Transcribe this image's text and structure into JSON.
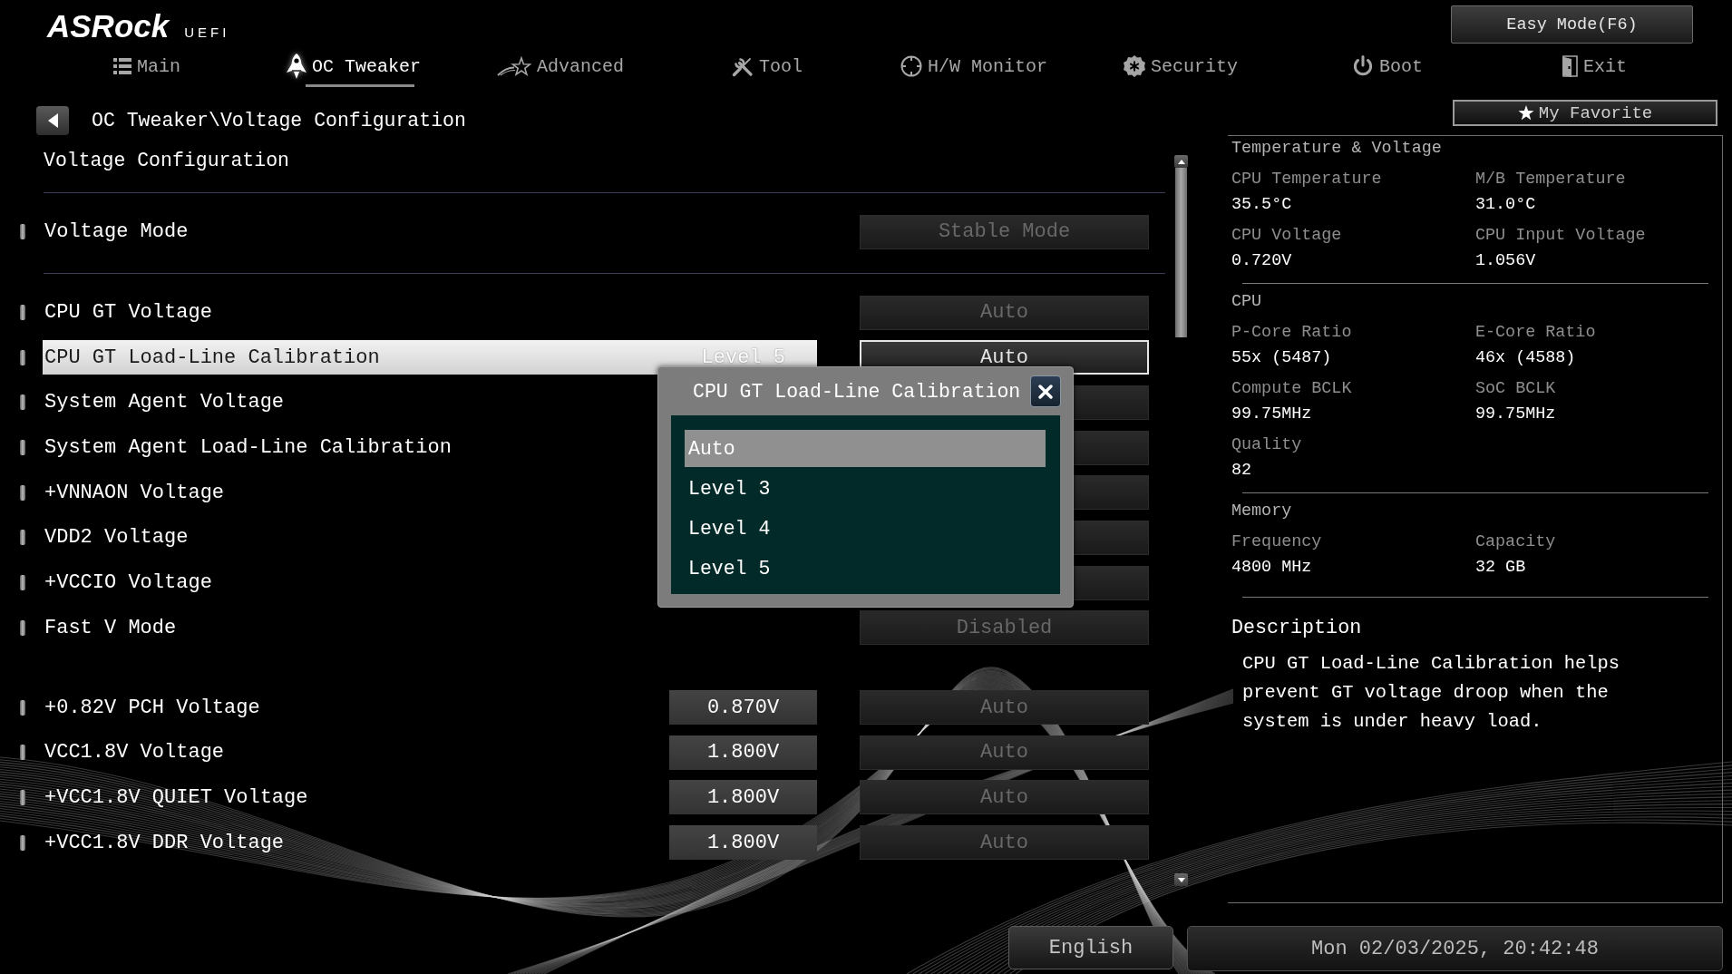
{
  "header": {
    "logo": "ASRock",
    "logo_suffix": "UEFI",
    "easy_mode_button": "Easy Mode(F6)"
  },
  "tabs": [
    {
      "label": "Main",
      "selected": false
    },
    {
      "label": "OC Tweaker",
      "selected": true
    },
    {
      "label": "Advanced",
      "selected": false
    },
    {
      "label": "Tool",
      "selected": false
    },
    {
      "label": "H/W Monitor",
      "selected": false
    },
    {
      "label": "Security",
      "selected": false
    },
    {
      "label": "Boot",
      "selected": false
    },
    {
      "label": "Exit",
      "selected": false
    }
  ],
  "breadcrumb": "OC Tweaker\\Voltage Configuration",
  "page_title": "Voltage Configuration",
  "sections": [
    {
      "divider": true,
      "settings": [
        {
          "label": "Voltage Mode",
          "value": "Stable Mode",
          "selected": false
        }
      ]
    },
    {
      "divider": true,
      "settings": [
        {
          "label": "CPU GT Voltage",
          "value": "Auto",
          "selected": false
        },
        {
          "label": "CPU GT Load-Line Calibration",
          "current": "Level 5",
          "value": "Auto",
          "selected": true
        },
        {
          "label": "System Agent Voltage",
          "selected": false
        },
        {
          "label": "System Agent Load-Line Calibration",
          "selected": false
        },
        {
          "label": "+VNNAON Voltage",
          "selected": false
        },
        {
          "label": "VDD2 Voltage",
          "selected": false
        },
        {
          "label": "+VCCIO Voltage",
          "selected": false
        },
        {
          "label": "Fast V Mode",
          "value": "Disabled",
          "selected": false
        }
      ]
    },
    {
      "divider": false,
      "settings": [
        {
          "label": "+0.82V PCH Voltage",
          "reading": "0.870V",
          "value": "Auto",
          "selected": false
        },
        {
          "label": "VCC1.8V Voltage",
          "reading": "1.800V",
          "value": "Auto",
          "selected": false
        },
        {
          "label": "+VCC1.8V QUIET Voltage",
          "reading": "1.800V",
          "value": "Auto",
          "selected": false
        },
        {
          "label": "+VCC1.8V DDR Voltage",
          "reading": "1.800V",
          "value": "Auto",
          "selected": false
        }
      ]
    }
  ],
  "popup": {
    "title": "CPU GT Load-Line Calibration",
    "options": [
      {
        "label": "Auto",
        "selected": true
      },
      {
        "label": "Level 3",
        "selected": false
      },
      {
        "label": "Level 4",
        "selected": false
      },
      {
        "label": "Level 5",
        "selected": false
      }
    ]
  },
  "favorite_button": "My Favorite",
  "monitor": {
    "groups": [
      {
        "title": "Temperature & Voltage",
        "items": [
          {
            "label": "CPU Temperature",
            "value": "35.5°C"
          },
          {
            "label": "M/B Temperature",
            "value": "31.0°C"
          },
          {
            "label": "CPU Voltage",
            "value": "0.720V"
          },
          {
            "label": "CPU Input Voltage",
            "value": "1.056V"
          }
        ]
      },
      {
        "title": "CPU",
        "items": [
          {
            "label": "P-Core Ratio",
            "value": "55x (5487)"
          },
          {
            "label": "E-Core Ratio",
            "value": "46x (4588)"
          },
          {
            "label": "Compute BCLK",
            "value": "99.75MHz"
          },
          {
            "label": "SoC BCLK",
            "value": "99.75MHz"
          },
          {
            "label": "Quality",
            "value": "82"
          }
        ]
      },
      {
        "title": "Memory",
        "items": [
          {
            "label": "Frequency",
            "value": "4800 MHz"
          },
          {
            "label": "Capacity",
            "value": "32 GB"
          }
        ]
      }
    ]
  },
  "description": {
    "title": "Description",
    "text": "CPU GT Load-Line Calibration helps prevent GT voltage droop when the system is under heavy load."
  },
  "footer": {
    "language": "English",
    "datetime": "Mon 02/03/2025, 20:42:48"
  }
}
